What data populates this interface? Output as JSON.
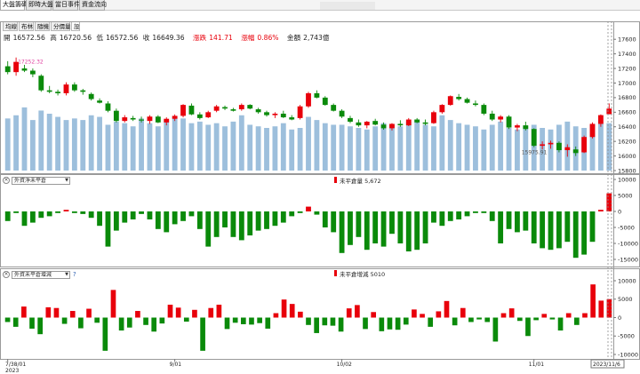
{
  "top_tabs": [
    {
      "label": "大盤籌碼",
      "active": true
    },
    {
      "label": "即時大盤",
      "active": false
    },
    {
      "label": "當日事件",
      "active": false
    },
    {
      "label": "資金流向",
      "active": false
    }
  ],
  "sub_tabs": [
    {
      "label": "均線",
      "active": false
    },
    {
      "label": "布林",
      "active": false
    },
    {
      "label": "隨機",
      "active": false
    },
    {
      "label": "分價量",
      "active": false
    },
    {
      "label": "設",
      "active": true
    }
  ],
  "quote": {
    "open_label": "開",
    "open": "16572.56",
    "high_label": "高",
    "high": "16720.56",
    "low_label": "低",
    "low": "16572.56",
    "close_label": "收",
    "close": "16649.36",
    "change_label": "漲跌",
    "change": "141.71",
    "pct_label": "漲幅",
    "pct": "0.86%",
    "amount_label": "金額",
    "amount": "2,743億"
  },
  "colors": {
    "up": "#e8000b",
    "down": "#0a8a0a",
    "volume": "#9dbfdc",
    "grid": "#cccccc"
  },
  "panel2": {
    "select": "外資淨未平倉",
    "legend": "未平倉量 5,672"
  },
  "panel3": {
    "select": "外資未平倉增減",
    "legend": "未平倉增減 5010",
    "help": "?"
  },
  "x_axis": {
    "labels": [
      "7/38/01",
      "9/01",
      "10/02",
      "11/01"
    ],
    "year": "2023",
    "cursor": "2023/11/6"
  },
  "chart_data": [
    {
      "type": "candlestick",
      "ylim": [
        15800,
        17700
      ],
      "yticks": [
        15800,
        16000,
        16200,
        16400,
        16600,
        16800,
        17000,
        17200,
        17400,
        17600
      ],
      "annotations": [
        {
          "text": "17252.32",
          "x": 1
        },
        {
          "text": "15975.91",
          "x": 63
        }
      ],
      "candles": [
        [
          17230,
          17300,
          17120,
          17150
        ],
        [
          17150,
          17350,
          17100,
          17290
        ],
        [
          17200,
          17250,
          17150,
          17170
        ],
        [
          17170,
          17200,
          17080,
          17120
        ],
        [
          17100,
          17120,
          16880,
          16900
        ],
        [
          16900,
          16960,
          16860,
          16880
        ],
        [
          16880,
          16910,
          16830,
          16860
        ],
        [
          16860,
          17010,
          16830,
          16980
        ],
        [
          16980,
          17010,
          16880,
          16900
        ],
        [
          16900,
          16920,
          16840,
          16880
        ],
        [
          16850,
          16870,
          16760,
          16780
        ],
        [
          16760,
          16790,
          16720,
          16730
        ],
        [
          16720,
          16750,
          16600,
          16620
        ],
        [
          16620,
          16650,
          16460,
          16480
        ],
        [
          16480,
          16560,
          16460,
          16530
        ],
        [
          16520,
          16550,
          16480,
          16500
        ],
        [
          16500,
          16540,
          16460,
          16490
        ],
        [
          16480,
          16560,
          16440,
          16540
        ],
        [
          16540,
          16560,
          16450,
          16460
        ],
        [
          16460,
          16530,
          16420,
          16510
        ],
        [
          16510,
          16570,
          16480,
          16550
        ],
        [
          16550,
          16710,
          16530,
          16700
        ],
        [
          16690,
          16720,
          16560,
          16570
        ],
        [
          16570,
          16600,
          16500,
          16520
        ],
        [
          16530,
          16620,
          16520,
          16600
        ],
        [
          16620,
          16700,
          16600,
          16680
        ],
        [
          16670,
          16690,
          16630,
          16650
        ],
        [
          16640,
          16660,
          16610,
          16620
        ],
        [
          16640,
          16720,
          16620,
          16700
        ],
        [
          16700,
          16710,
          16640,
          16650
        ],
        [
          16640,
          16660,
          16580,
          16600
        ],
        [
          16600,
          16620,
          16540,
          16560
        ],
        [
          16560,
          16600,
          16520,
          16580
        ],
        [
          16580,
          16620,
          16520,
          16530
        ],
        [
          16530,
          16560,
          16490,
          16500
        ],
        [
          16520,
          16700,
          16500,
          16680
        ],
        [
          16680,
          16880,
          16660,
          16860
        ],
        [
          16860,
          16900,
          16790,
          16800
        ],
        [
          16800,
          16820,
          16690,
          16700
        ],
        [
          16700,
          16720,
          16610,
          16620
        ],
        [
          16620,
          16640,
          16520,
          16540
        ],
        [
          16520,
          16550,
          16450,
          16470
        ],
        [
          16460,
          16500,
          16400,
          16420
        ],
        [
          16420,
          16480,
          16380,
          16470
        ],
        [
          16480,
          16510,
          16420,
          16430
        ],
        [
          16430,
          16460,
          16360,
          16380
        ],
        [
          16380,
          16450,
          16350,
          16440
        ],
        [
          16440,
          16490,
          16400,
          16420
        ],
        [
          16420,
          16520,
          16410,
          16500
        ],
        [
          16500,
          16520,
          16450,
          16460
        ],
        [
          16460,
          16500,
          16420,
          16440
        ],
        [
          16450,
          16620,
          16440,
          16600
        ],
        [
          16600,
          16710,
          16580,
          16700
        ],
        [
          16700,
          16830,
          16690,
          16820
        ],
        [
          16810,
          16850,
          16760,
          16780
        ],
        [
          16780,
          16800,
          16720,
          16730
        ],
        [
          16720,
          16760,
          16680,
          16700
        ],
        [
          16700,
          16720,
          16560,
          16580
        ],
        [
          16580,
          16620,
          16480,
          16500
        ],
        [
          16500,
          16560,
          16460,
          16540
        ],
        [
          16540,
          16560,
          16370,
          16390
        ],
        [
          16390,
          16440,
          16340,
          16420
        ],
        [
          16420,
          16470,
          16350,
          16370
        ],
        [
          16370,
          16380,
          16120,
          16140
        ],
        [
          16140,
          16200,
          16090,
          16160
        ],
        [
          16160,
          16210,
          16100,
          16180
        ],
        [
          16180,
          16200,
          16050,
          16080
        ],
        [
          16080,
          16160,
          15990,
          16120
        ],
        [
          16090,
          16130,
          16000,
          16040
        ],
        [
          16050,
          16280,
          16040,
          16260
        ],
        [
          16260,
          16460,
          16240,
          16440
        ],
        [
          16440,
          16570,
          16400,
          16560
        ],
        [
          16572.56,
          16720.56,
          16572.56,
          16649.36
        ]
      ],
      "volume_ylim": [
        0,
        4500
      ],
      "volume": [
        3300,
        3500,
        4000,
        3200,
        3800,
        3600,
        3400,
        3200,
        3300,
        3200,
        3500,
        3400,
        2900,
        3100,
        3000,
        2800,
        3300,
        3000,
        2800,
        3200,
        3400,
        3300,
        3000,
        3100,
        2900,
        3000,
        2800,
        3100,
        3500,
        2900,
        2800,
        2700,
        2800,
        3000,
        2600,
        2700,
        3400,
        3200,
        3000,
        2900,
        2900,
        2800,
        2700,
        2600,
        2800,
        3000,
        2900,
        2800,
        3100,
        3200,
        2900,
        2800,
        3500,
        3200,
        3000,
        2900,
        2800,
        2600,
        2900,
        3100,
        2700,
        2600,
        2800,
        2900,
        2700,
        2600,
        2900,
        3100,
        2800,
        2700,
        2900,
        3000,
        3000
      ]
    },
    {
      "type": "bar",
      "name": "未平倉量",
      "ylim": [
        -15000,
        10000
      ],
      "yticks": [
        -15000,
        -10000,
        -5000,
        0,
        5000,
        10000
      ],
      "values": [
        -3000,
        -500,
        -4500,
        -3500,
        -2000,
        -1500,
        -500,
        500,
        -500,
        -800,
        -2000,
        -4500,
        -11000,
        -6000,
        -3500,
        -2500,
        -800,
        -2500,
        -5500,
        -6500,
        -4000,
        -3000,
        -1500,
        -5500,
        -11000,
        -8000,
        -5000,
        -8000,
        -9000,
        -7500,
        -6000,
        -5500,
        -4500,
        -3500,
        -1500,
        -500,
        1500,
        -1000,
        -5000,
        -6500,
        -13000,
        -10500,
        -8000,
        -12000,
        -10000,
        -11000,
        -7000,
        -10000,
        -12500,
        -12000,
        -10000,
        -3500,
        -4500,
        -3000,
        -2500,
        -1500,
        -500,
        -500,
        -3000,
        -10000,
        -5500,
        -6500,
        -6000,
        -10000,
        -11500,
        -12000,
        -11500,
        -9500,
        -14500,
        -13500,
        -9500,
        500,
        5672
      ]
    },
    {
      "type": "bar",
      "name": "未平倉增減",
      "ylim": [
        -10000,
        10000
      ],
      "yticks": [
        -10000,
        -5000,
        0,
        5000,
        10000
      ],
      "values": [
        -1200,
        -2500,
        3000,
        -3000,
        -4500,
        2800,
        2600,
        -1700,
        1800,
        -2900,
        2400,
        -1400,
        -9000,
        7500,
        -3500,
        -2700,
        1800,
        -2000,
        -3800,
        -1600,
        3500,
        2700,
        -1100,
        2100,
        -9000,
        2600,
        3500,
        -3100,
        -1400,
        -1800,
        -1900,
        -1500,
        -3000,
        1200,
        4900,
        3700,
        1600,
        -2000,
        -4200,
        -2100,
        -2200,
        -3800,
        2500,
        3400,
        -3100,
        1500,
        -3700,
        -3200,
        -3300,
        -1900,
        2200,
        1000,
        -2500,
        1700,
        4500,
        -2100,
        2600,
        -1200,
        -500,
        -1200,
        -6500,
        1200,
        2500,
        -900,
        -5000,
        -700,
        1000,
        -500,
        -3500,
        1200,
        -2000,
        1200,
        9000,
        4600,
        5010
      ]
    }
  ]
}
